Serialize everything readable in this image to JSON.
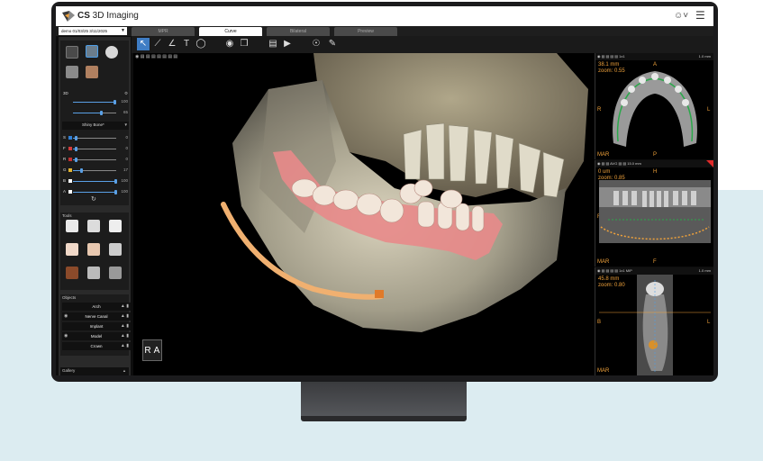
{
  "app": {
    "title_bold": "CS",
    "title_rest": " 3D Imaging",
    "patient": "demo 01/03/25 3/11/2025"
  },
  "tabs": [
    "MPR",
    "Curve",
    "Bilateral",
    "Preview"
  ],
  "active_tab": "Curve",
  "left_panel": {
    "rendering_value": "3D",
    "slider_top_1": "100",
    "slider_top_2": "65",
    "preset": "Shiny Bone*",
    "channels": [
      {
        "label": "S",
        "value": "0",
        "color": "#2f7fd6",
        "level": 0.05
      },
      {
        "label": "F",
        "value": "0",
        "color": "#d43a3a",
        "level": 0.05
      },
      {
        "label": "R",
        "value": "0",
        "color": "#c23030",
        "level": 0.05
      },
      {
        "label": "G",
        "value": "17",
        "color": "#e2b430",
        "level": 0.17
      },
      {
        "label": "B",
        "value": "100",
        "color": "#ffffff",
        "level": 1.0
      },
      {
        "label": "A",
        "value": "100",
        "color": "#ffffff",
        "level": 1.0
      }
    ],
    "tools_label": "Tools",
    "objects_label": "Objects",
    "objects": [
      {
        "name": "Arch",
        "eye": false
      },
      {
        "name": "Nerve Canal",
        "eye": true
      },
      {
        "name": "Implant",
        "eye": false
      },
      {
        "name": "Model",
        "eye": true
      },
      {
        "name": "Crown",
        "eye": false
      }
    ],
    "gallery_label": "Gallery"
  },
  "cube": {
    "left": "R",
    "right": "A"
  },
  "axial": {
    "thick": "38.1 mm",
    "zoom": "zoom: 0.55",
    "top": "A",
    "bottom": "P",
    "left": "R",
    "right": "L",
    "mar": "MAR",
    "scale": "1.0 mm"
  },
  "panoramic": {
    "thick": "0 um",
    "zoom": "zoom: 0.85",
    "tag": "AVG",
    "slice": "15.0 mm",
    "top": "H",
    "bottom": "F",
    "left": "R",
    "right": "L",
    "mar": "MAR"
  },
  "cross": {
    "thick": "45.8 mm",
    "zoom": "zoom: 0.80",
    "left": "B",
    "right": "L",
    "mar": "MAR",
    "scale": "1.0 mm",
    "tag": "MIP"
  },
  "colors": {
    "accent": "#3f7dc4",
    "orange": "#f0a23b",
    "blue": "#4c9ee8"
  }
}
